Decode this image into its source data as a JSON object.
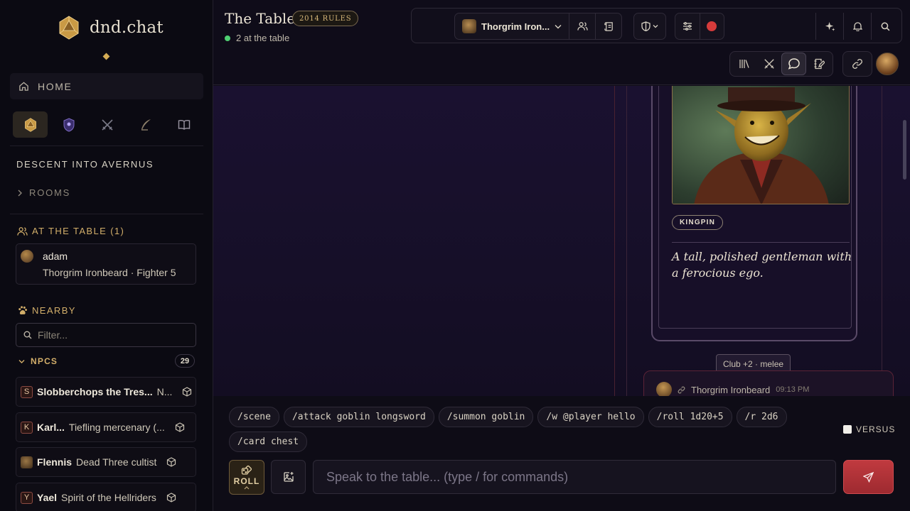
{
  "brand": {
    "name": "dnd.chat"
  },
  "sidebar": {
    "home_label": "HOME",
    "tabs": [
      {
        "icon": "d20-icon",
        "active": true
      },
      {
        "icon": "shield-crest-icon",
        "active": false
      },
      {
        "icon": "crossed-swords-icon",
        "active": false
      },
      {
        "icon": "quill-icon",
        "active": false
      },
      {
        "icon": "book-icon",
        "active": false
      }
    ],
    "campaign_title": "DESCENT INTO AVERNUS",
    "rooms_label": "ROOMS",
    "at_table": {
      "label": "AT THE TABLE (1)",
      "players": [
        {
          "name": "adam",
          "character": "Thorgrim Ironbeard · Fighter 5"
        }
      ]
    },
    "nearby": {
      "label": "NEARBY",
      "filter_placeholder": "Filter...",
      "npcs_label": "NPCS",
      "npcs_count": "29",
      "npcs": [
        {
          "letter": "S",
          "name": "Slobberchops the Tres...",
          "desc": "N..."
        },
        {
          "letter": "K",
          "name": "Karl...",
          "desc": "Tiefling mercenary (..."
        },
        {
          "letter": "",
          "name": "Flennis",
          "desc": "Dead Three cultist"
        },
        {
          "letter": "Y",
          "name": "Yael",
          "desc": "Spirit of the Hellriders"
        }
      ]
    }
  },
  "header": {
    "title": "The Table",
    "rules_badge": "2014 RULES",
    "presence": "2 at the table",
    "character_select": "Thorgrim Iron...",
    "colors": {
      "accent_gold": "#d4ac55",
      "record": "#d63b3b",
      "online": "#4fcf72",
      "send": "#b83238"
    }
  },
  "feed": {
    "npc_card": {
      "role": "KINGPIN",
      "description": "A tall, polished gentleman with a ferocious ego."
    },
    "tooltip": "Club +2 · melee",
    "message": {
      "author": "Thorgrim Ironbeard",
      "time": "09:13 PM"
    }
  },
  "composer": {
    "commands": [
      "/scene",
      "/attack goblin longsword",
      "/summon goblin",
      "/w @player hello",
      "/roll 1d20+5",
      "/r 2d6",
      "/card chest"
    ],
    "versus_label": "VERSUS",
    "roll_label": "ROLL",
    "input_placeholder": "Speak to the table... (type / for commands)"
  }
}
